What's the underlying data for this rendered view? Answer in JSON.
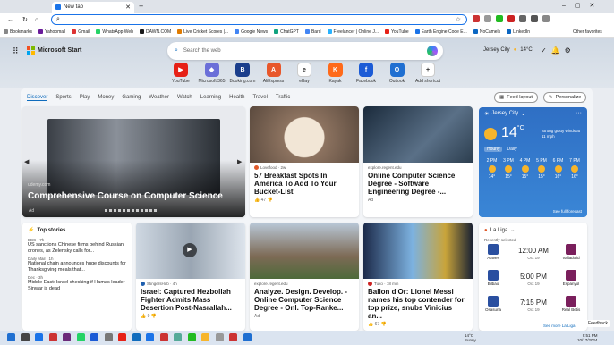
{
  "browser": {
    "tab_title": "New tab",
    "address_value": "",
    "bookmarks": [
      "Bookmarks",
      "Yahoomail",
      "Gmail",
      "WhatsApp Web",
      "DAWN.COM",
      "Live Cricket Scores |...",
      "Google News",
      "ChatGPT",
      "Bard",
      "Freelancer | Online J...",
      "YouTube",
      "Earth Engine Code E...",
      "NoCamels",
      "LinkedIn"
    ],
    "other_favorites": "Other favorites"
  },
  "msn": {
    "brand": "Microsoft Start",
    "search_placeholder": "Search the web",
    "location": "Jersey City",
    "temp": "14°C",
    "quicklinks": [
      {
        "label": "YouTube",
        "color": "#e62117",
        "glyph": "▶"
      },
      {
        "label": "Microsoft 365",
        "color": "#6b6fd8",
        "glyph": "◆"
      },
      {
        "label": "Booking.com",
        "color": "#1a3e8c",
        "glyph": "B"
      },
      {
        "label": "AliExpress",
        "color": "#e8572b",
        "glyph": "A"
      },
      {
        "label": "eBay",
        "color": "#ffffff",
        "glyph": "e"
      },
      {
        "label": "Kayak",
        "color": "#ff6a1a",
        "glyph": "K"
      },
      {
        "label": "Facebook",
        "color": "#1b5bd6",
        "glyph": "f"
      },
      {
        "label": "Outlook",
        "color": "#1f6fd1",
        "glyph": "O"
      },
      {
        "label": "Add shortcut",
        "color": "#ffffff",
        "glyph": "+"
      }
    ]
  },
  "nav": {
    "tabs": [
      "Discover",
      "Sports",
      "Play",
      "Money",
      "Gaming",
      "Weather",
      "Watch",
      "Learning",
      "Health",
      "Travel",
      "Traffic"
    ],
    "feed_layout": "Feed layout",
    "personalize": "Personalize"
  },
  "hero": {
    "source": "udemy.com",
    "title": "Comprehensive Course on Computer Science",
    "ad": "Ad"
  },
  "card1": {
    "source": "Lovefood · 2w",
    "title": "57 Breakfast Spots In America To Add To Your Bucket-List",
    "likes": "47"
  },
  "card2": {
    "source": "explore.regent.edu",
    "title": "Online Computer Science Degree - Software Engineering Degree -...",
    "ad": "Ad"
  },
  "weather": {
    "location": "Jersey City",
    "temp": "14",
    "unit": "°C",
    "desc": "Strong gusty winds at 11 mph",
    "tabs": [
      "Hourly",
      "Daily"
    ],
    "hours": [
      {
        "t": "2 PM",
        "v": "14°"
      },
      {
        "t": "3 PM",
        "v": "15°"
      },
      {
        "t": "4 PM",
        "v": "15°"
      },
      {
        "t": "5 PM",
        "v": "15°"
      },
      {
        "t": "6 PM",
        "v": "16°"
      },
      {
        "t": "7 PM",
        "v": "16°"
      }
    ],
    "forecast_link": "See full forecast"
  },
  "topstories": {
    "header": "Top stories",
    "items": [
      {
        "src": "BBC · 7h",
        "title": "US sanctions Chinese firms behind Russian drones, as Zelensky calls for..."
      },
      {
        "src": "Daily Mail · 1h",
        "title": "National chain announces huge discounts for Thanksgiving meals that..."
      },
      {
        "src": "Dec · 3h",
        "title": "Middle East: Israel checking if Hamas leader Sinwar is dead"
      }
    ]
  },
  "card3": {
    "source": "StingersHub · 4h",
    "title": "Israel: Captured Hezbollah Fighter Admits Mass Desertion Post-Nasrallah...",
    "likes": "9"
  },
  "card4": {
    "source": "explore.regent.edu",
    "title": "Analyze. Design. Develop. - Online Computer Science Degree - Onl. Top-Ranke...",
    "ad": "Ad"
  },
  "card5": {
    "source": "Tuko · 18 min",
    "title": "Ballon d'Or: Lionel Messi names his top contender for top prize, snubs Vinicius an...",
    "likes": "67"
  },
  "laliga": {
    "header": "La Liga",
    "recent": "Recently selected",
    "matches": [
      {
        "home": "Alaves",
        "away": "Valladolid",
        "time": "12:00 AM",
        "date": "Oct 19"
      },
      {
        "home": "Bilbao",
        "away": "Espanyol",
        "time": "5:00 PM",
        "date": "Oct 19"
      },
      {
        "home": "Osasuna",
        "away": "Real Betis",
        "time": "7:15 PM",
        "date": "Oct 19"
      }
    ],
    "see_more": "See more La Liga"
  },
  "taskbar": {
    "temp": "14°C",
    "weather": "Sunny",
    "time": "9:51 PM",
    "date": "10/17/2024"
  },
  "feedback": "Feedback"
}
